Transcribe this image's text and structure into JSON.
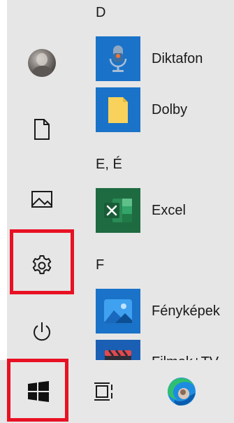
{
  "start_menu": {
    "rail": {
      "avatar_icon": "user-avatar",
      "documents_icon": "document-icon",
      "pictures_icon": "picture-icon",
      "settings_icon": "gear-icon",
      "power_icon": "power-icon"
    },
    "groups": [
      {
        "letter": "D",
        "apps": [
          {
            "label": "Diktafon",
            "icon": "microphone-icon",
            "tile_color": "#1a73c8"
          },
          {
            "label": "Dolby",
            "icon": "folder-icon",
            "tile_color": "#1a73c8"
          }
        ]
      },
      {
        "letter": "E, É",
        "apps": [
          {
            "label": "Excel",
            "icon": "excel-icon",
            "tile_color": "#1e6b41"
          }
        ]
      },
      {
        "letter": "F",
        "apps": [
          {
            "label": "Fényképek",
            "icon": "photos-icon",
            "tile_color": "#1a73c8"
          },
          {
            "label": "Filmek+TV",
            "icon": "movies-icon",
            "tile_color": "#1a5fb4"
          }
        ]
      }
    ]
  },
  "taskbar": {
    "start_icon": "windows-logo-icon",
    "task_view_icon": "task-view-icon",
    "edge_icon": "edge-icon"
  },
  "colors": {
    "highlight": "#e81123",
    "menu_background": "#e6e6e6",
    "taskbar_background": "#e7e7e7",
    "app_tile_blue": "#1a73c8",
    "excel_green": "#1e6b41"
  }
}
